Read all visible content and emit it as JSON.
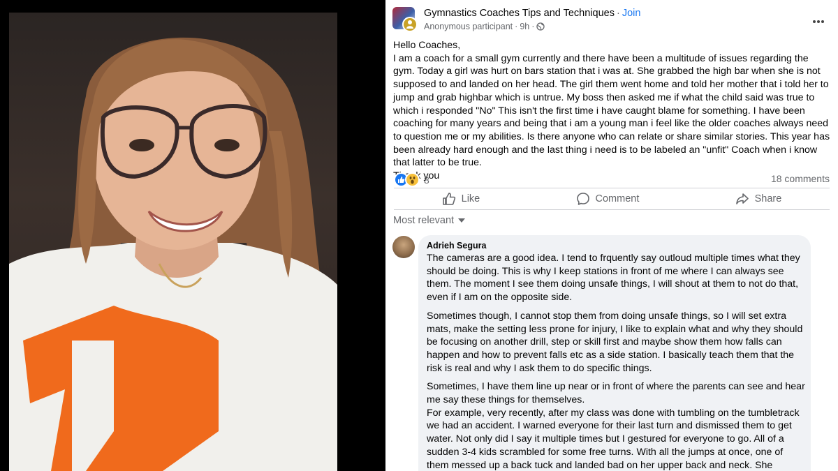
{
  "photo": {
    "description_icon": "selfie-photo"
  },
  "post": {
    "group_name": "Gymnastics Coaches Tips and Techniques",
    "separator": "·",
    "join_label": "Join",
    "author": "Anonymous participant",
    "time": "9h",
    "privacy_icon": "globe-icon",
    "body": [
      "Hello Coaches,",
      "I am a coach for a small gym currently and there have been a multitude of issues regarding the gym. Today a girl was hurt on bars station that i was at. She grabbed the high bar when she is not supposed to and landed on her head. The girl them went home and told her mother that i told her to jump and grab highbar which is untrue. My boss then asked me if what the child said was true to which i responded \"No\" This isn't the first time i have caught blame for something. I have been coaching for many years and being that i am a young man i feel like the older coaches always need to question me or my abilities. Is there anyone who can relate or share similar stories. This year has been already hard enough and the last thing i need is to be labeled an \"unfit\" Coach when i know that latter to be true.",
      "Thank you"
    ],
    "reaction_count": "8",
    "comments_count": "18 comments",
    "actions": {
      "like": "Like",
      "comment": "Comment",
      "share": "Share"
    },
    "sort_label": "Most relevant"
  },
  "comment": {
    "author": "Adrieh Segura",
    "paragraphs": [
      "The cameras are a good idea. I tend to frquently say outloud multiple times what they should be doing. This is why I keep stations in front of me where I can always see them. The moment I see them doing unsafe things, I will shout at them to not do that, even if I am on the opposite side.",
      "Sometimes though, I cannot stop them from doing unsafe things, so I will set extra mats, make the setting less prone for injury, I like to explain what and why they should be focusing on another drill, step or skill first and maybe show them how falls can happen and how to prevent falls etc as a side station. I basically teach them that the risk is real and why I ask them to do specific things.",
      "Sometimes, I have them line up near or in front of where the parents can see and hear me say these things for themselves.",
      "For example, very recently, after my class was done with tumbling on the tumbletrack we had an accident. I warned everyone for their last turn and dismissed them to get water. Not only did I say it multiple times but I gestured for everyone to go. All of a sudden 3-4 kids scrambled for some free turns. With all the jumps at once, one of them messed up a back tuck and landed bad on her upper back and neck. She squashed"
    ]
  },
  "colors": {
    "link": "#1877f2",
    "secondary_text": "#65676b",
    "bubble_bg": "#f0f2f5"
  }
}
